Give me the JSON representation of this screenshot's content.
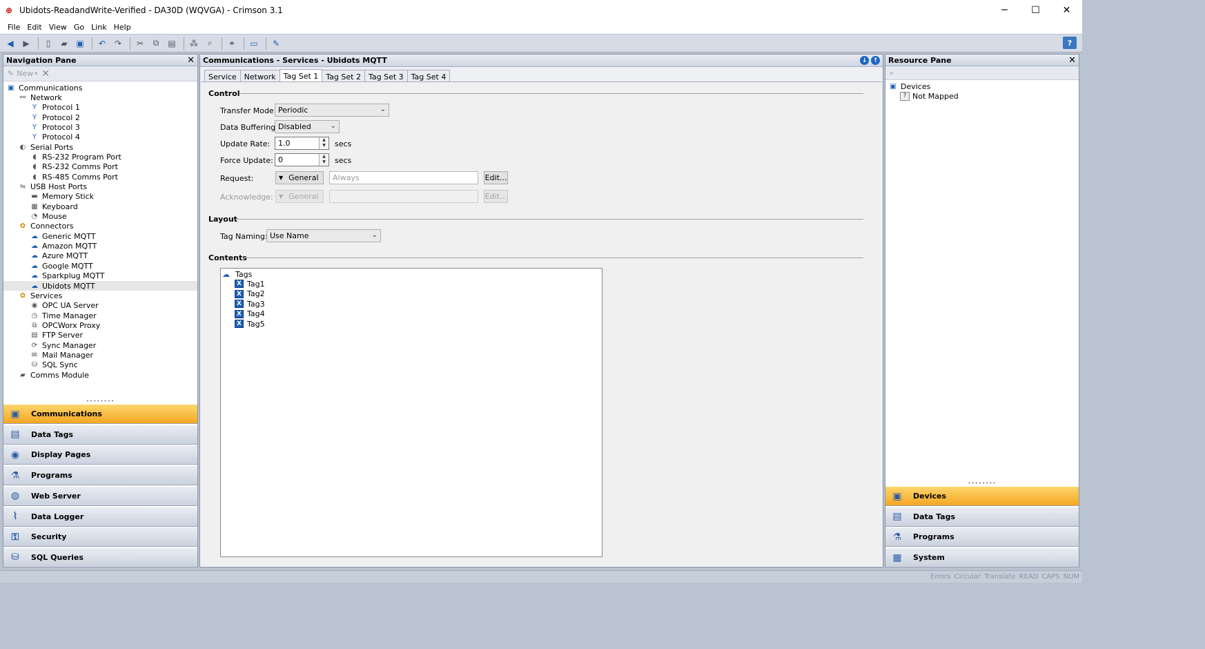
{
  "window": {
    "title": "Ubidots-ReadandWrite-Verified - DA30D (WQVGA) - Crimson 3.1",
    "minimize": "─",
    "maximize": "☐",
    "close": "✕"
  },
  "menu": [
    "File",
    "Edit",
    "View",
    "Go",
    "Link",
    "Help"
  ],
  "toolbar": {
    "help": "?"
  },
  "nav_pane": {
    "title": "Navigation Pane",
    "new_label": "New",
    "tree": [
      {
        "label": "Communications",
        "level": 0,
        "icon": "communications-icon",
        "exp": ""
      },
      {
        "label": "Network",
        "level": 1,
        "icon": "network-icon",
        "exp": "−"
      },
      {
        "label": "Protocol 1",
        "level": 2,
        "icon": "protocol-icon",
        "exp": ""
      },
      {
        "label": "Protocol 2",
        "level": 2,
        "icon": "protocol-icon",
        "exp": ""
      },
      {
        "label": "Protocol 3",
        "level": 2,
        "icon": "protocol-icon",
        "exp": ""
      },
      {
        "label": "Protocol 4",
        "level": 2,
        "icon": "protocol-icon",
        "exp": ""
      },
      {
        "label": "Serial Ports",
        "level": 1,
        "icon": "serial-ports-icon",
        "exp": "−"
      },
      {
        "label": "RS-232 Program Port",
        "level": 2,
        "icon": "serial-port-icon",
        "exp": ""
      },
      {
        "label": "RS-232 Comms Port",
        "level": 2,
        "icon": "serial-port-icon",
        "exp": ""
      },
      {
        "label": "RS-485 Comms Port",
        "level": 2,
        "icon": "serial-port-icon",
        "exp": ""
      },
      {
        "label": "USB Host Ports",
        "level": 1,
        "icon": "usb-icon",
        "exp": "−"
      },
      {
        "label": "Memory Stick",
        "level": 2,
        "icon": "memory-stick-icon",
        "exp": ""
      },
      {
        "label": "Keyboard",
        "level": 2,
        "icon": "keyboard-icon",
        "exp": ""
      },
      {
        "label": "Mouse",
        "level": 2,
        "icon": "mouse-icon",
        "exp": ""
      },
      {
        "label": "Connectors",
        "level": 1,
        "icon": "connectors-icon",
        "exp": "−"
      },
      {
        "label": "Generic MQTT",
        "level": 2,
        "icon": "cloud-icon",
        "exp": ""
      },
      {
        "label": "Amazon MQTT",
        "level": 2,
        "icon": "cloud-icon",
        "exp": ""
      },
      {
        "label": "Azure MQTT",
        "level": 2,
        "icon": "cloud-icon",
        "exp": ""
      },
      {
        "label": "Google MQTT",
        "level": 2,
        "icon": "cloud-icon",
        "exp": ""
      },
      {
        "label": "Sparkplug MQTT",
        "level": 2,
        "icon": "cloud-icon",
        "exp": ""
      },
      {
        "label": "Ubidots MQTT",
        "level": 2,
        "icon": "cloud-icon",
        "exp": "",
        "selected": true
      },
      {
        "label": "Services",
        "level": 1,
        "icon": "services-icon",
        "exp": "−"
      },
      {
        "label": "OPC UA Server",
        "level": 2,
        "icon": "opc-ua-icon",
        "exp": ""
      },
      {
        "label": "Time Manager",
        "level": 2,
        "icon": "clock-icon",
        "exp": ""
      },
      {
        "label": "OPCWorx Proxy",
        "level": 2,
        "icon": "proxy-icon",
        "exp": ""
      },
      {
        "label": "FTP Server",
        "level": 2,
        "icon": "ftp-icon",
        "exp": ""
      },
      {
        "label": "Sync Manager",
        "level": 2,
        "icon": "sync-icon",
        "exp": ""
      },
      {
        "label": "Mail Manager",
        "level": 2,
        "icon": "mail-icon",
        "exp": ""
      },
      {
        "label": "SQL Sync",
        "level": 2,
        "icon": "sql-sync-icon",
        "exp": ""
      },
      {
        "label": "Comms Module",
        "level": 1,
        "icon": "comms-module-icon",
        "exp": ""
      }
    ],
    "categories": [
      {
        "label": "Communications",
        "icon": "communications-icon",
        "active": true
      },
      {
        "label": "Data Tags",
        "icon": "data-tags-icon"
      },
      {
        "label": "Display Pages",
        "icon": "display-pages-icon"
      },
      {
        "label": "Programs",
        "icon": "programs-icon"
      },
      {
        "label": "Web Server",
        "icon": "web-server-icon"
      },
      {
        "label": "Data Logger",
        "icon": "data-logger-icon"
      },
      {
        "label": "Security",
        "icon": "security-icon"
      },
      {
        "label": "SQL Queries",
        "icon": "sql-queries-icon"
      }
    ]
  },
  "main": {
    "title": "Communications - Services - Ubidots MQTT",
    "tabs": [
      "Service",
      "Network",
      "Tag Set 1",
      "Tag Set 2",
      "Tag Set 3",
      "Tag Set 4"
    ],
    "active_tab": "Tag Set 1",
    "control": {
      "section": "Control",
      "transfer_mode_label": "Transfer Mode:",
      "transfer_mode_value": "Periodic",
      "data_buffering_label": "Data Buffering:",
      "data_buffering_value": "Disabled",
      "update_rate_label": "Update Rate:",
      "update_rate_value": "1.0",
      "update_rate_unit": "secs",
      "force_update_label": "Force Update:",
      "force_update_value": "0",
      "force_update_unit": "secs",
      "request_label": "Request:",
      "request_type": "General",
      "request_placeholder": "Always",
      "request_edit": "Edit...",
      "acknowledge_label": "Acknowledge:",
      "acknowledge_type": "General",
      "acknowledge_edit": "Edit..."
    },
    "layout": {
      "section": "Layout",
      "tag_naming_label": "Tag Naming:",
      "tag_naming_value": "Use Name"
    },
    "contents": {
      "section": "Contents",
      "root": "Tags",
      "tags": [
        "Tag1",
        "Tag2",
        "Tag3",
        "Tag4",
        "Tag5"
      ]
    }
  },
  "resource_pane": {
    "title": "Resource Pane",
    "tree": [
      {
        "label": "Devices",
        "level": 0,
        "icon": "devices-icon"
      },
      {
        "label": "Not Mapped",
        "level": 1,
        "icon": "question-icon"
      }
    ],
    "categories": [
      {
        "label": "Devices",
        "icon": "devices-icon",
        "active": true
      },
      {
        "label": "Data Tags",
        "icon": "data-tags-icon"
      },
      {
        "label": "Programs",
        "icon": "programs-icon"
      },
      {
        "label": "System",
        "icon": "system-icon"
      }
    ]
  },
  "status": [
    "Errors",
    "Circular",
    "Translate",
    "READ",
    "CAPS",
    "NUM"
  ],
  "colors": {
    "active_category": "#f5a623",
    "selection": "#e6e6e6",
    "accent": "#1d5fb6"
  }
}
